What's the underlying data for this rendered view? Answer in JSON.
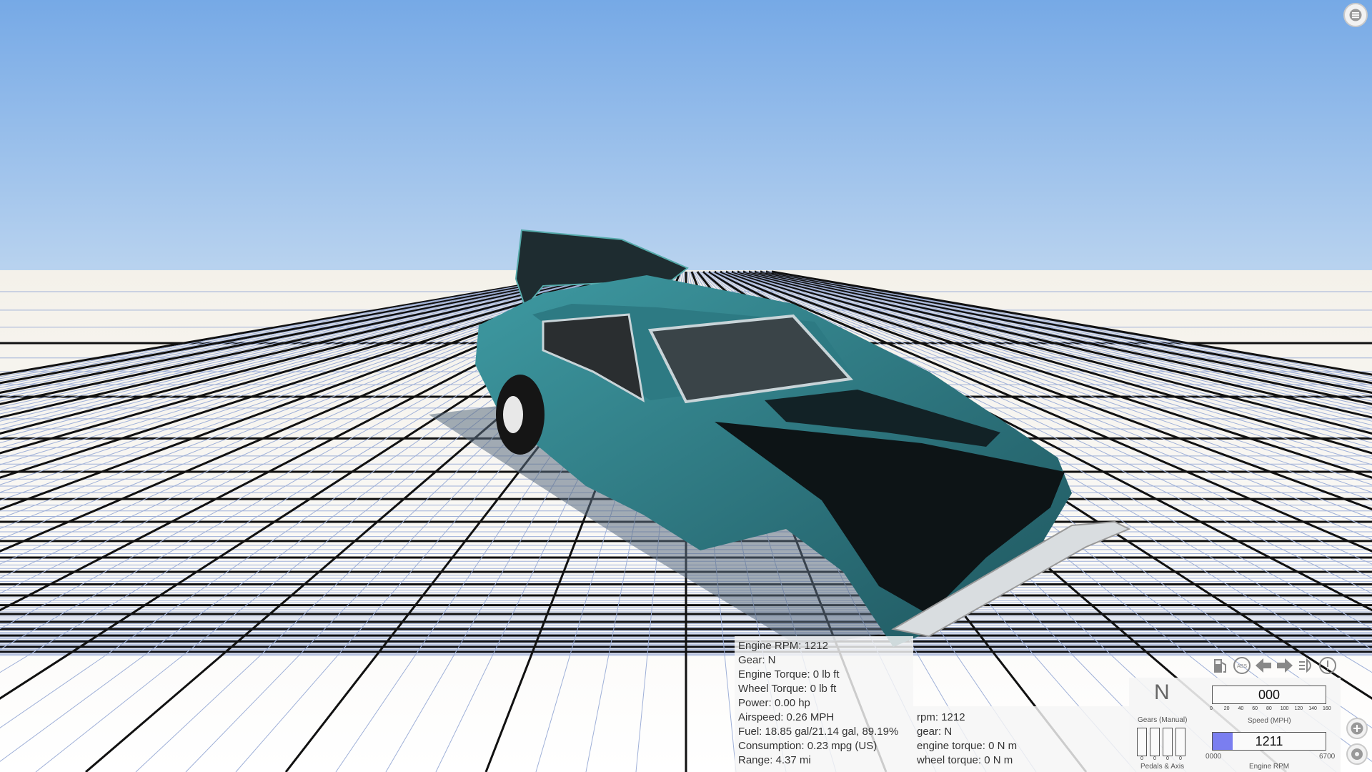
{
  "hud": {
    "menu_icon": "hamburger-icon",
    "zoom_in_icon": "plus-icon",
    "settings_icon": "gear-icon"
  },
  "debug_engine": {
    "lines": [
      "Engine RPM: 1212",
      "Gear: N",
      "Engine Torque: 0 lb ft",
      "Wheel Torque: 0 lb ft",
      "Power: 0.00 hp",
      "Airspeed: 0.26 MPH",
      "Fuel: 18.85 gal/21.14 gal, 89.19%",
      "Consumption: 0.23 mpg (US)",
      "Range: 4.37 mi"
    ]
  },
  "debug_drivetrain": {
    "lines": [
      "rpm: 1212",
      "gear: N",
      "engine torque: 0 N m",
      "wheel torque: 0 N m"
    ]
  },
  "dashboard": {
    "status_icons": [
      "fuel-icon",
      "abs-icon",
      "left-signal-icon",
      "right-signal-icon",
      "headlight-icon",
      "warning-icon"
    ],
    "gear": "N",
    "gears_label": "Gears (Manual)",
    "speed": "000",
    "speed_label": "Speed (MPH)",
    "speed_ticks": [
      "0",
      "20",
      "40",
      "60",
      "80",
      "100",
      "120",
      "140",
      "160"
    ],
    "rpm": "1211",
    "rpm_fraction": 0.18,
    "rpm_min": "0000",
    "rpm_max": "6700",
    "rpm_label": "Engine RPM",
    "pedals_label": "Pedals & Axis",
    "pedal_values": [
      "0",
      "0",
      "0",
      "0"
    ]
  },
  "colors": {
    "sky_top": "#76a9e6",
    "car_body": "#2e7e86",
    "rpm_fill": "#7a7ef0"
  }
}
